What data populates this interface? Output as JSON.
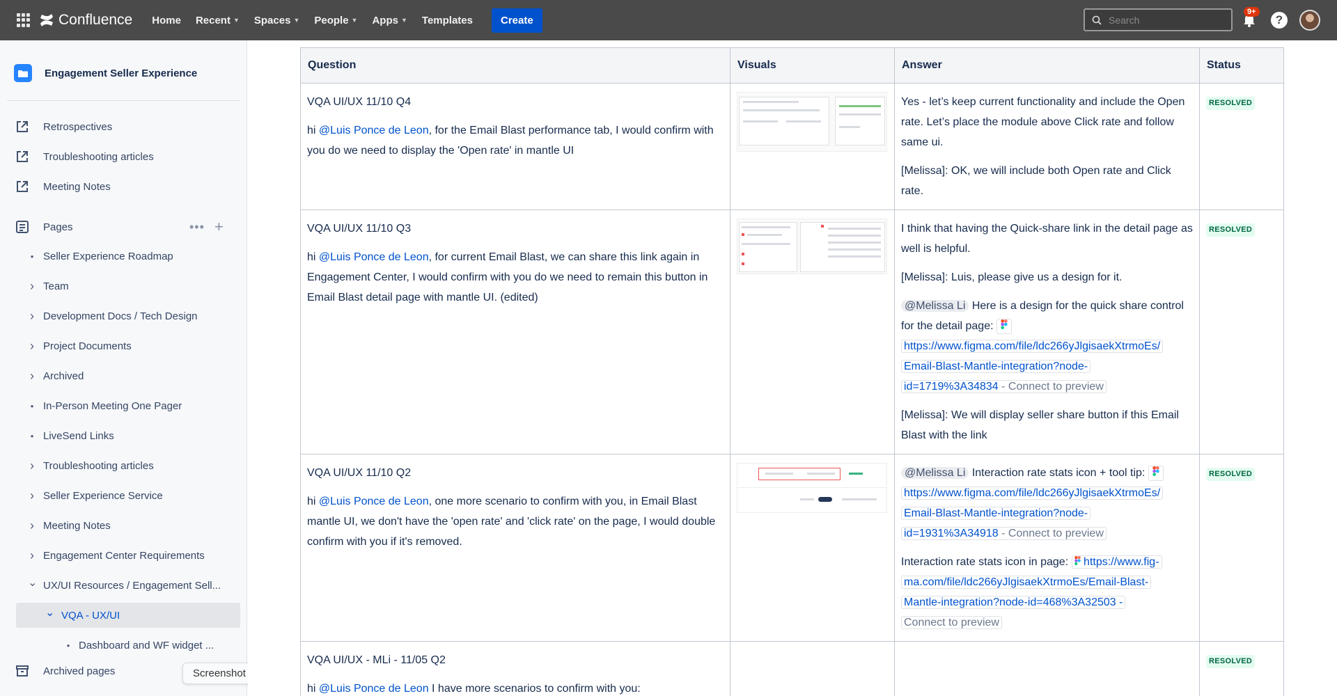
{
  "nav": {
    "brand": "Confluence",
    "items": [
      {
        "label": "Home",
        "dropdown": false
      },
      {
        "label": "Recent",
        "dropdown": true
      },
      {
        "label": "Spaces",
        "dropdown": true
      },
      {
        "label": "People",
        "dropdown": true
      },
      {
        "label": "Apps",
        "dropdown": true
      },
      {
        "label": "Templates",
        "dropdown": false
      }
    ],
    "create_label": "Create",
    "search_placeholder": "Search",
    "notification_badge": "9+",
    "help_glyph": "?"
  },
  "sidebar": {
    "space_name": "Engagement Seller Experience",
    "shortcuts": [
      "Retrospectives",
      "Troubleshooting articles",
      "Meeting Notes"
    ],
    "pages_label": "Pages",
    "tree": [
      {
        "label": "Seller Experience Roadmap",
        "mark": "bullet"
      },
      {
        "label": "Team",
        "mark": "chevron"
      },
      {
        "label": "Development Docs / Tech Design",
        "mark": "chevron"
      },
      {
        "label": "Project Documents",
        "mark": "chevron"
      },
      {
        "label": "Archived",
        "mark": "chevron"
      },
      {
        "label": "In-Person Meeting One Pager",
        "mark": "bullet"
      },
      {
        "label": "LiveSend Links",
        "mark": "bullet"
      },
      {
        "label": "Troubleshooting articles",
        "mark": "chevron"
      },
      {
        "label": "Seller Experience Service",
        "mark": "chevron"
      },
      {
        "label": "Meeting Notes",
        "mark": "chevron"
      },
      {
        "label": "Engagement Center Requirements",
        "mark": "chevron"
      },
      {
        "label": "UX/UI Resources / Engagement Sell...",
        "mark": "expanded"
      },
      {
        "label": "VQA - UX/UI",
        "mark": "expanded",
        "active": true
      },
      {
        "label": "Dashboard and WF widget ...",
        "mark": "bullet",
        "child": true
      }
    ],
    "archived_label": "Archived pages",
    "tooltip": "Screenshot"
  },
  "table": {
    "headers": [
      "Question",
      "Visuals",
      "Answer",
      "Status"
    ],
    "rows": [
      {
        "title": "VQA UI/UX 11/10 Q4",
        "q_prefix": "hi ",
        "mention": "@Luis Ponce de Leon",
        "q_body": ", for the Email Blast performance tab, I would confirm with you do we need to display the 'Open rate' in mantle UI",
        "answer_1": "Yes  - let’s keep current functionality and include the Open rate. Let’s place the module above Click rate and follow same ui.",
        "answer_2": "[Melissa]: OK, we will include both Open rate and Click rate.",
        "status": "RESOLVED"
      },
      {
        "title": "VQA UI/UX 11/10 Q3",
        "q_prefix": "hi ",
        "mention": "@Luis Ponce de Leon",
        "q_body": ", for current Email Blast, we can share this link again in Engagement Center, I would confirm with you do we need to remain this button in Email Blast detail page with mantle UI. (edited)",
        "answer_1": "I think that having the Quick-share link in the detail page as well is helpful.",
        "answer_2": "[Melissa]: Luis, please give us a design for it.",
        "answer_mention": "@Melissa Li",
        "answer_3": " Here is a design for the quick share control for the detail page: ",
        "link_1": "https://www.figma.com/file/ldc266yJlgisaekXtrmoEs/",
        "link_2": "Email-Blast-Mantle-integration?node-",
        "link_3": "id=1719%3A34834",
        "connect": " - Connect to preview",
        "answer_4": "[Melissa]: We will display seller share button if this Email Blast with the link",
        "status": "RESOLVED"
      },
      {
        "title": "VQA UI/UX 11/10 Q2",
        "q_prefix": "hi ",
        "mention": "@Luis Ponce de Leon",
        "q_body": ",  one more scenario to confirm with you, in Email Blast mantle UI, we don't have the 'open rate' and 'click rate' on the page, I would double confirm with you if it's removed.",
        "answer_mention": "@Melissa Li",
        "answer_1": " Interaction rate stats icon + tool tip: ",
        "link_1": "https://www.figma.com/file/ldc266yJlgisaekXtrmoEs/",
        "link_2": "Email-Blast-Mantle-integration?node-",
        "link_3": "id=1931%3A34918",
        "connect": " - Connect to preview",
        "answer_2": "Interaction rate stats icon in page: ",
        "link_4": "https://www.fig-",
        "link_5": "ma.com/file/ldc266yJlgisaekXtrmoEs/Email-Blast-",
        "link_6": "Mantle-integration?node-id=468%3A32503",
        "link_7": " - ",
        "connect_2": "Connect to preview",
        "status": "RESOLVED"
      },
      {
        "title": "VQA UI/UX - MLi - 11/05 Q2",
        "q_prefix": "hi ",
        "mention": "@Luis Ponce de Leon",
        "q_body": " I have more scenarios to confirm with you:",
        "status": "RESOLVED"
      }
    ]
  }
}
